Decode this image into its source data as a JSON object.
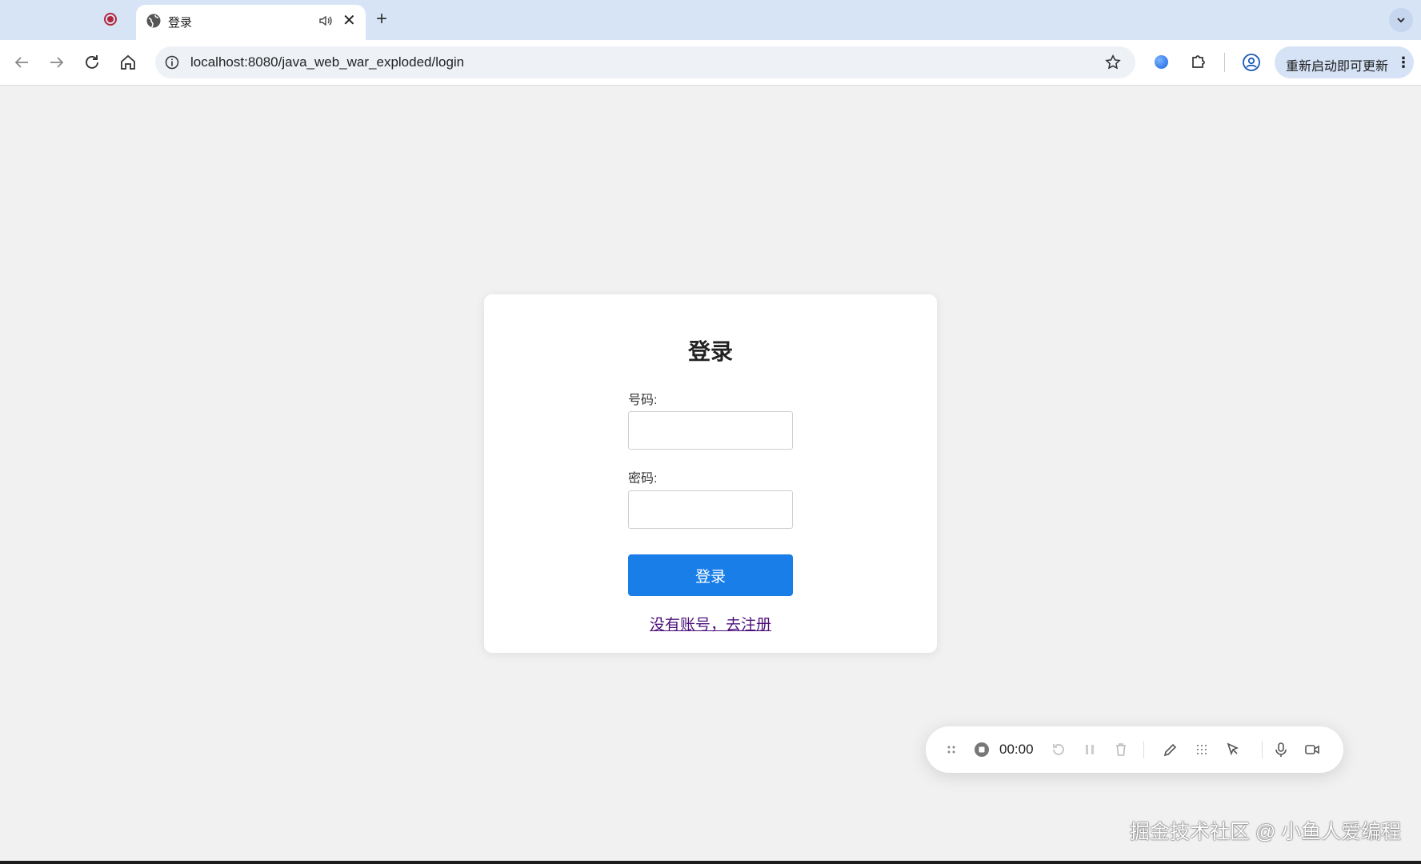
{
  "browser": {
    "tab": {
      "title": "登录"
    },
    "new_tab_symbol": "+",
    "close_symbol": "✕",
    "address": {
      "url": "localhost:8080/java_web_war_exploded/login"
    },
    "update_button": {
      "label": "重新启动即可更新",
      "more_symbol": "⋮"
    }
  },
  "login_card": {
    "title": "登录",
    "phone_label": "号码:",
    "phone_value": "",
    "password_label": "密码:",
    "password_value": "",
    "submit_label": "登录",
    "register_link": "没有账号，去注册"
  },
  "recorder": {
    "time": "00:00",
    "icons": [
      "drag-handle-icon",
      "stop-icon",
      "restart-icon",
      "pause-icon",
      "delete-icon",
      "pen-icon",
      "grid-icon",
      "pointer-icon",
      "microphone-icon",
      "camera-icon"
    ]
  },
  "watermark": "掘金技术社区 @ 小鱼人爱编程",
  "colors": {
    "primary_button": "#1a7ee8",
    "link": "#4b0f7a",
    "tabstrip": "#d7e4f6"
  }
}
